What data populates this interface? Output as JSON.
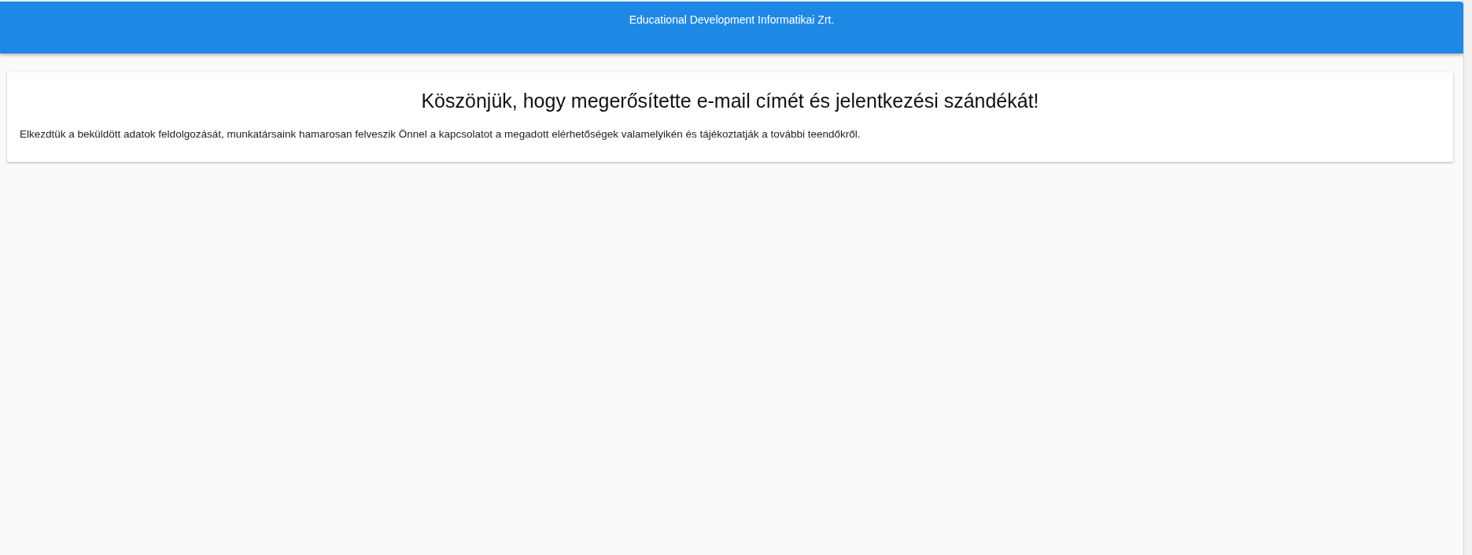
{
  "header": {
    "title": "Educational Development Informatikai Zrt."
  },
  "card": {
    "heading": "Köszönjük, hogy megerősítette e-mail címét és jelentkezési szándékát!",
    "message": "Elkezdtük a beküldött adatok feldolgozását, munkatársaink hamarosan felveszik Önnel a kapcsolatot a megadott elérhetőségek valamelyikén és tájékoztatják a további teendőkről."
  }
}
